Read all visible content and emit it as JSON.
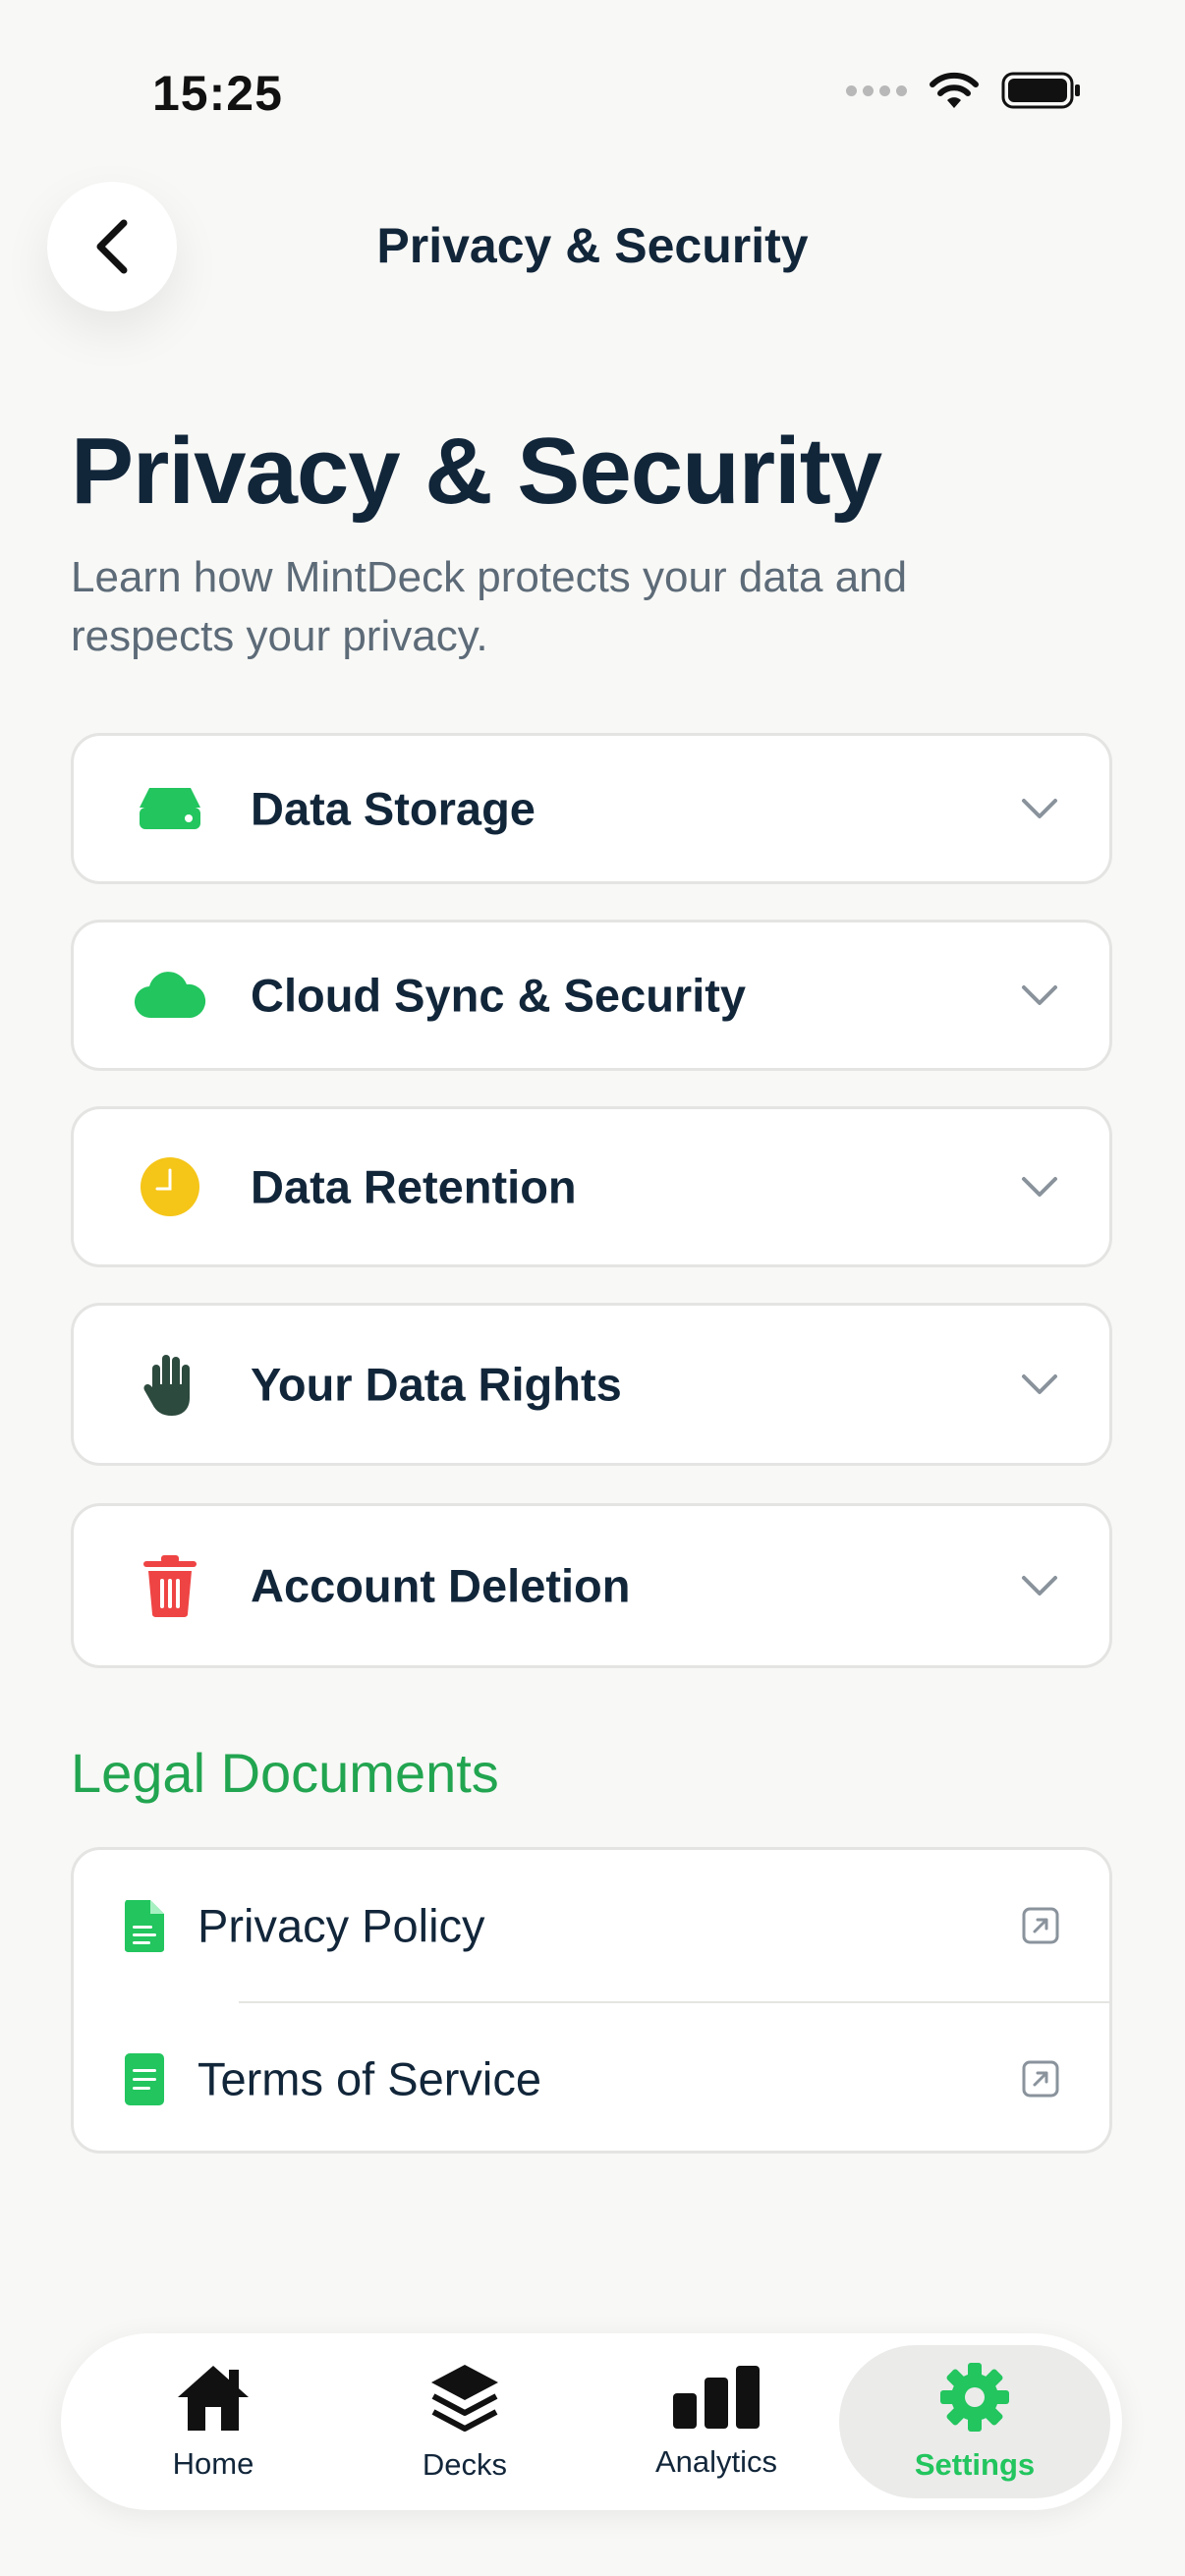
{
  "status_bar": {
    "time": "15:25"
  },
  "nav": {
    "title": "Privacy & Security"
  },
  "header": {
    "title": "Privacy & Security",
    "subtitle": "Learn how MintDeck protects your data and respects your privacy."
  },
  "sections": [
    {
      "label": "Data Storage",
      "icon": "hard-drive-icon",
      "color": "#22c55e"
    },
    {
      "label": "Cloud Sync & Security",
      "icon": "cloud-icon",
      "color": "#22c55e"
    },
    {
      "label": "Data Retention",
      "icon": "clock-icon",
      "color": "#f5c518"
    },
    {
      "label": "Your Data Rights",
      "icon": "hand-icon",
      "color": "#2d4a3e"
    },
    {
      "label": "Account Deletion",
      "icon": "trash-icon",
      "color": "#ef4444"
    }
  ],
  "legal": {
    "title": "Legal Documents",
    "items": [
      {
        "label": "Privacy Policy",
        "icon": "document-icon"
      },
      {
        "label": "Terms of Service",
        "icon": "document-icon"
      }
    ]
  },
  "tabs": [
    {
      "label": "Home",
      "icon": "home-icon"
    },
    {
      "label": "Decks",
      "icon": "layers-icon"
    },
    {
      "label": "Analytics",
      "icon": "bar-chart-icon"
    },
    {
      "label": "Settings",
      "icon": "gear-icon",
      "active": true
    }
  ],
  "colors": {
    "accent": "#22c55e",
    "text": "#12263a",
    "muted": "#5d6b78",
    "border": "#e4e4e2"
  }
}
